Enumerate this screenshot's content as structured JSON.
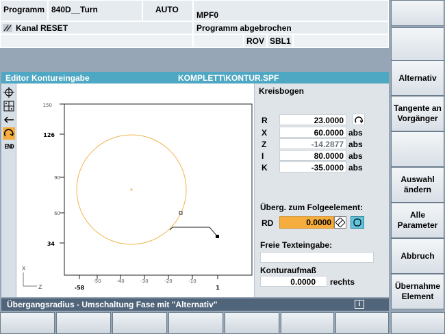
{
  "header": {
    "area": "Programm",
    "machine": "840D__Turn",
    "mode": "AUTO",
    "program": "MPF0",
    "channel_status": "Kanal RESET",
    "program_status": "Programm abgebrochen",
    "flags": [
      "ROV",
      "SBL1"
    ]
  },
  "softkeys_right": [
    {
      "label": ""
    },
    {
      "label": "Alternativ"
    },
    {
      "label": "Tangente an Vorgänger"
    },
    {
      "label": ""
    },
    {
      "label": "Auswahl ändern"
    },
    {
      "label": "Alle Parameter"
    },
    {
      "label": "Abbruch"
    },
    {
      "label": "Übernahme Element"
    }
  ],
  "editor": {
    "title": "Editor  Kontureingabe",
    "file": "KOMPLETT\\KONTUR.SPF"
  },
  "toolbar_icons": [
    "crosshair-icon",
    "grid-icon",
    "line-left-icon",
    "arc-icon",
    "end-icon"
  ],
  "tool_end_label": "END",
  "graphic": {
    "y_ticks": [
      "150",
      "126",
      "90",
      "60",
      "34"
    ],
    "x_ticks": [
      "-58",
      "-50",
      "-40",
      "-30",
      "-20",
      "-10",
      "1"
    ],
    "axis_x_label": "X",
    "axis_z_label": "Z"
  },
  "panel": {
    "title": "Kreisbogen",
    "fields": [
      {
        "name": "R",
        "value": "23.0000",
        "unit": ""
      },
      {
        "name": "X",
        "value": "60.0000",
        "unit": "abs"
      },
      {
        "name": "Z",
        "value": "-14.2877",
        "unit": "abs"
      },
      {
        "name": "I",
        "value": "80.0000",
        "unit": "abs"
      },
      {
        "name": "K",
        "value": "-35.0000",
        "unit": "abs"
      }
    ],
    "transition_label": "Überg. zum Folgeelement:",
    "rd_label": "RD",
    "rd_value": "0.0000",
    "freetext_label": "Freie Texteingabe:",
    "freetext_value": "",
    "allowance_label": "Konturaufmaß",
    "allowance_value": "0.0000",
    "allowance_side": "rechts"
  },
  "status": {
    "message": "Übergangsradius   -   Umschaltung Fase mit \"Alternativ\"",
    "info_icon": "i"
  },
  "colors": {
    "editor_title": "#4ea7c3",
    "highlight": "#f5ad3d",
    "arc": "#f0b44a",
    "status_bar": "#51657a"
  }
}
